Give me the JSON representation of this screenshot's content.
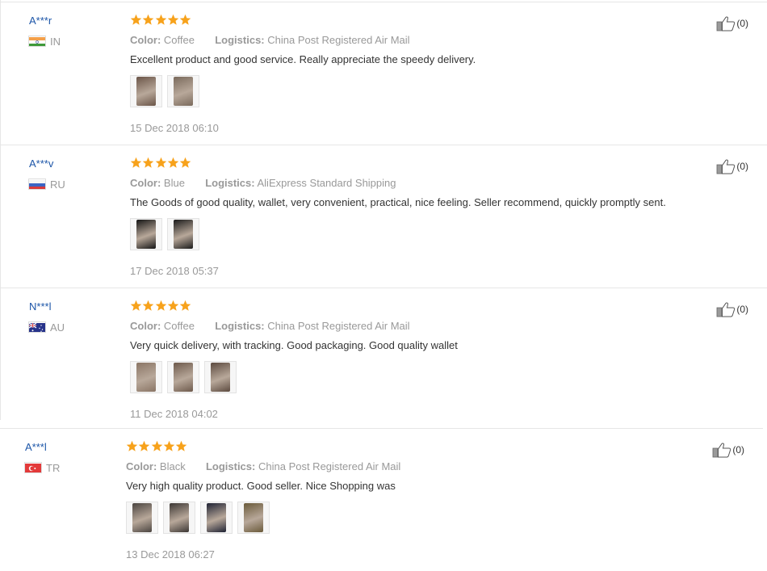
{
  "reviews": [
    {
      "user": "A***r",
      "country_code": "IN",
      "flag": "india",
      "rating": 5,
      "color_label": "Color:",
      "color_value": "Coffee",
      "logistics_label": "Logistics:",
      "logistics_value": "China Post Registered Air Mail",
      "comment": "Excellent product and good service. Really appreciate the speedy delivery.",
      "photos": [
        "#6b5548",
        "#7a6a5c"
      ],
      "date": "15 Dec 2018 06:10",
      "likes": "(0)"
    },
    {
      "user": "A***v",
      "country_code": "RU",
      "flag": "russia",
      "rating": 5,
      "color_label": "Color:",
      "color_value": "Blue",
      "logistics_label": "Logistics:",
      "logistics_value": "AliExpress Standard Shipping",
      "comment": "The Goods of good quality, wallet, very convenient, practical, nice feeling. Seller recommend, quickly promptly sent.",
      "photos": [
        "#141414",
        "#1a1a1a"
      ],
      "date": "17 Dec 2018 05:37",
      "likes": "(0)"
    },
    {
      "user": "N***l",
      "country_code": "AU",
      "flag": "australia",
      "rating": 5,
      "color_label": "Color:",
      "color_value": "Coffee",
      "logistics_label": "Logistics:",
      "logistics_value": "China Post Registered Air Mail",
      "comment": "Very quick delivery, with tracking. Good packaging. Good quality wallet",
      "photos": [
        "#8a7565",
        "#6e5a4c",
        "#5c4a3f"
      ],
      "date": "11 Dec 2018 04:02",
      "likes": "(0)"
    },
    {
      "user": "A***l",
      "country_code": "TR",
      "flag": "turkey",
      "rating": 5,
      "color_label": "Color:",
      "color_value": "Black",
      "logistics_label": "Logistics:",
      "logistics_value": "China Post Registered Air Mail",
      "comment": "Very high quality product. Good seller. Nice Shopping was",
      "photos": [
        "#4a4440",
        "#3c3734",
        "#1e2233",
        "#6a5a3a"
      ],
      "date": "13 Dec 2018 06:27",
      "likes": "(0)"
    }
  ],
  "colors": {
    "star": "#f7a21b",
    "username": "#1d56a8",
    "muted": "#999999"
  }
}
